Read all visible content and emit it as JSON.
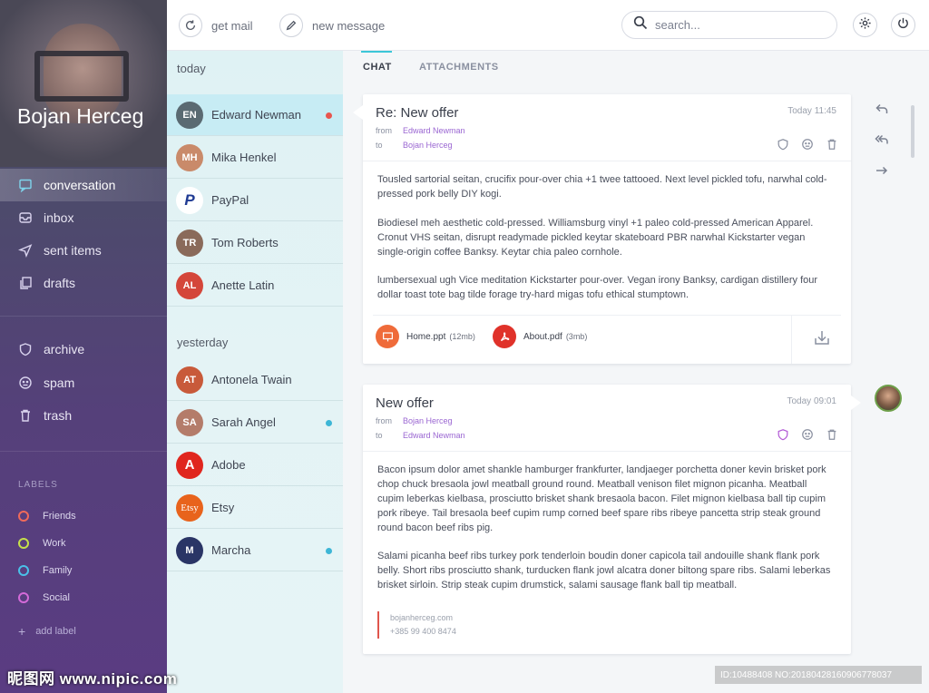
{
  "sidebar": {
    "user_name": "Bojan Herceg",
    "nav": [
      {
        "label": "conversation",
        "icon": "chat-icon",
        "active": true
      },
      {
        "label": "inbox",
        "icon": "inbox-icon"
      },
      {
        "label": "sent items",
        "icon": "send-icon"
      },
      {
        "label": "drafts",
        "icon": "drafts-icon"
      }
    ],
    "nav2": [
      {
        "label": "archive",
        "icon": "shield-icon"
      },
      {
        "label": "spam",
        "icon": "spam-icon"
      },
      {
        "label": "trash",
        "icon": "trash-icon"
      }
    ],
    "labels_title": "LABELS",
    "labels": [
      {
        "label": "Friends",
        "color": "#f06a5a"
      },
      {
        "label": "Work",
        "color": "#c6e04a"
      },
      {
        "label": "Family",
        "color": "#4ac0e8"
      },
      {
        "label": "Social",
        "color": "#d46ad9"
      }
    ],
    "add_label": "add label"
  },
  "topbar": {
    "get_mail": "get mail",
    "new_message": "new message",
    "search_placeholder": "search..."
  },
  "contacts": {
    "today_title": "today",
    "today": [
      {
        "name": "Edward Newman",
        "avatar_color": "#5a6a72",
        "initials": "EN",
        "dot": "#e8554e",
        "active": true
      },
      {
        "name": "Mika Henkel",
        "avatar_color": "#c98a6a",
        "initials": "MH"
      },
      {
        "name": "PayPal",
        "avatar_color": "#ffffff",
        "initials": "P",
        "text_color": "#1f3a93"
      },
      {
        "name": "Tom Roberts",
        "avatar_color": "#8a6a5a",
        "initials": "TR"
      },
      {
        "name": "Anette Latin",
        "avatar_color": "#d4463a",
        "initials": "AL"
      }
    ],
    "yesterday_title": "yesterday",
    "yesterday": [
      {
        "name": "Antonela Twain",
        "avatar_color": "#c85a3a",
        "initials": "AT"
      },
      {
        "name": "Sarah Angel",
        "avatar_color": "#b47c6a",
        "initials": "SA",
        "dot": "#3db6d6"
      },
      {
        "name": "Adobe",
        "avatar_color": "#e0261e",
        "initials": "A"
      },
      {
        "name": "Etsy",
        "avatar_color": "#e8631c",
        "initials": "Etsy"
      },
      {
        "name": "Marcha",
        "avatar_color": "#2a3566",
        "initials": "M",
        "dot": "#3db6d6"
      }
    ]
  },
  "tabs": {
    "chat": "CHAT",
    "attachments": "ATTACHMENTS"
  },
  "message1": {
    "subject": "Re: New offer",
    "date": "Today 11:45",
    "from_label": "from",
    "from": "Edward Newman",
    "to_label": "to",
    "to": "Bojan Herceg",
    "p1": "Tousled sartorial seitan, crucifix pour-over chia +1 twee tattooed. Next level pickled tofu, narwhal cold-pressed pork belly DIY kogi.",
    "p2": "Biodiesel meh aesthetic cold-pressed. Williamsburg vinyl +1 paleo cold-pressed American Apparel. Cronut VHS seitan, disrupt readymade pickled keytar skateboard PBR narwhal Kickstarter vegan single-origin coffee Banksy. Keytar chia paleo cornhole.",
    "p3": "lumbersexual ugh Vice meditation Kickstarter pour-over. Vegan irony Banksy, cardigan distillery four dollar toast tote bag tilde forage try-hard migas tofu ethical stumptown.",
    "attachments": [
      {
        "name": "Home.ppt",
        "size": "(12mb)",
        "color": "#ef6b3a"
      },
      {
        "name": "About.pdf",
        "size": "(3mb)",
        "color": "#e0322a"
      }
    ]
  },
  "message2": {
    "subject": "New offer",
    "date": "Today 09:01",
    "from_label": "from",
    "from": "Bojan Herceg",
    "to_label": "to",
    "to": "Edward Newman",
    "p1": "Bacon ipsum dolor amet shankle hamburger frankfurter, landjaeger porchetta doner kevin brisket pork chop chuck bresaola jowl meatball ground round. Meatball venison filet mignon picanha. Meatball cupim leberkas kielbasa, prosciutto brisket shank bresaola bacon. Filet mignon kielbasa ball tip cupim pork ribeye. Tail bresaola beef cupim rump corned beef spare ribs ribeye pancetta strip steak ground round bacon beef ribs pig.",
    "p2": "Salami picanha beef ribs turkey pork tenderloin boudin doner capicola tail andouille shank flank pork belly. Short ribs prosciutto shank, turducken flank jowl alcatra doner biltong spare ribs. Salami leberkas brisket sirloin. Strip steak cupim drumstick, salami sausage flank ball tip meatball.",
    "sig_site": "bojanherceg.com",
    "sig_phone": "+385 99 400 8474"
  },
  "watermark": {
    "brand": "昵图网 www.nipic.com",
    "id": "ID:10488408 NO:20180428160906778037"
  }
}
